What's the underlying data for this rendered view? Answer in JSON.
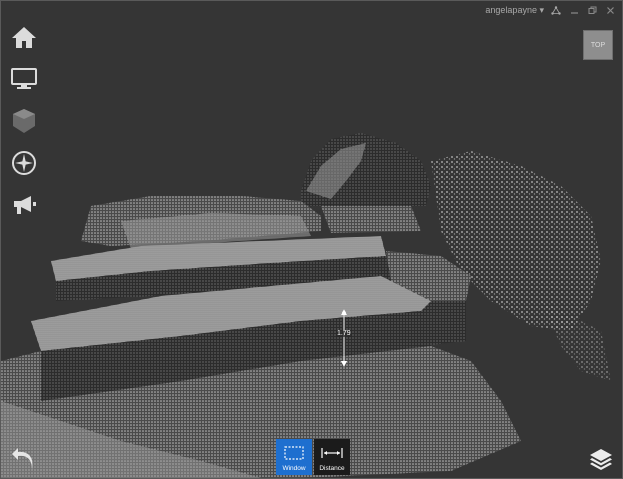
{
  "titlebar": {
    "user": "angelapayne"
  },
  "view_cube": {
    "label": "TOP"
  },
  "measurement": {
    "value": "1.79"
  },
  "toolbar": {
    "window_label": "Window",
    "distance_label": "Distance"
  },
  "colors": {
    "background": "#353535",
    "active_tool": "#1e6fcf",
    "inactive_tool": "#1b1b1b",
    "icon": "#dcdcdc"
  },
  "left_tools": [
    "home-icon",
    "monitor-icon",
    "shield-icon",
    "compass-icon",
    "megaphone-icon"
  ]
}
